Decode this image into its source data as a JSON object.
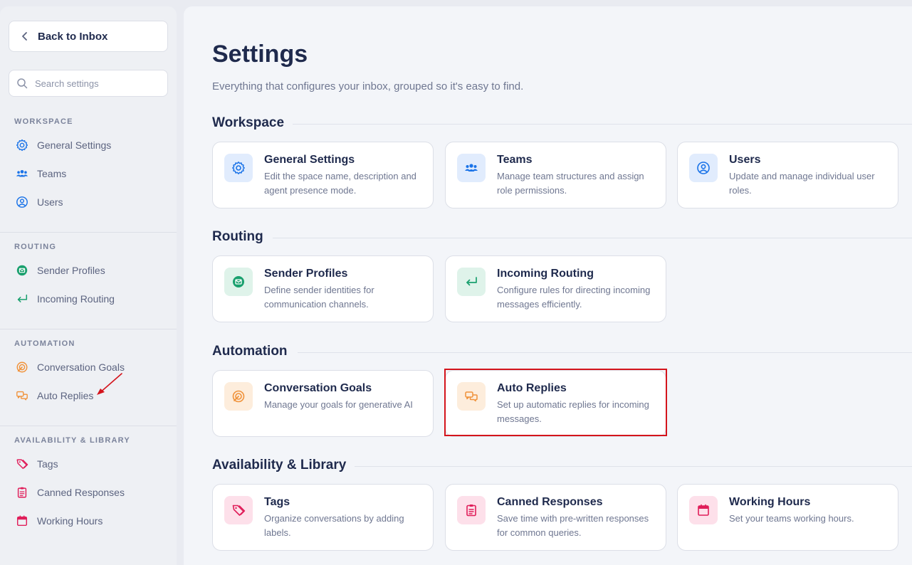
{
  "sidebar": {
    "back_label": "Back to Inbox",
    "search_placeholder": "Search settings",
    "groups": [
      {
        "title": "WORKSPACE",
        "items": [
          {
            "label": "General Settings",
            "icon": "gear-icon"
          },
          {
            "label": "Teams",
            "icon": "teams-icon"
          },
          {
            "label": "Users",
            "icon": "user-circle-icon"
          }
        ]
      },
      {
        "title": "ROUTING",
        "items": [
          {
            "label": "Sender Profiles",
            "icon": "mail-circle-icon"
          },
          {
            "label": "Incoming Routing",
            "icon": "return-arrow-icon"
          }
        ]
      },
      {
        "title": "AUTOMATION",
        "items": [
          {
            "label": "Conversation Goals",
            "icon": "target-icon"
          },
          {
            "label": "Auto Replies",
            "icon": "chat-bubbles-icon"
          }
        ]
      },
      {
        "title": "AVAILABILITY & LIBRARY",
        "items": [
          {
            "label": "Tags",
            "icon": "tag-icon"
          },
          {
            "label": "Canned Responses",
            "icon": "clipboard-icon"
          },
          {
            "label": "Working Hours",
            "icon": "calendar-icon"
          }
        ]
      }
    ]
  },
  "main": {
    "title": "Settings",
    "subtitle": "Everything that configures your inbox, grouped so it's easy to find.",
    "sections": [
      {
        "title": "Workspace",
        "cards": [
          {
            "title": "General Settings",
            "desc": "Edit the space name, description and agent presence mode.",
            "icon": "gear-icon"
          },
          {
            "title": "Teams",
            "desc": "Manage team structures and assign role permissions.",
            "icon": "teams-icon"
          },
          {
            "title": "Users",
            "desc": "Update and manage individual user roles.",
            "icon": "user-circle-icon"
          }
        ]
      },
      {
        "title": "Routing",
        "cards": [
          {
            "title": "Sender Profiles",
            "desc": "Define sender identities for communication channels.",
            "icon": "mail-circle-icon"
          },
          {
            "title": "Incoming Routing",
            "desc": "Configure rules for directing incoming messages efficiently.",
            "icon": "return-arrow-icon"
          }
        ]
      },
      {
        "title": "Automation",
        "cards": [
          {
            "title": "Conversation Goals",
            "desc": "Manage your goals for generative AI",
            "icon": "target-icon"
          },
          {
            "title": "Auto Replies",
            "desc": "Set up automatic replies for incoming messages.",
            "icon": "chat-bubbles-icon"
          }
        ]
      },
      {
        "title": "Availability & Library",
        "cards": [
          {
            "title": "Tags",
            "desc": "Organize conversations by adding labels.",
            "icon": "tag-icon"
          },
          {
            "title": "Canned Responses",
            "desc": "Save time with pre-written responses for common queries.",
            "icon": "clipboard-icon"
          },
          {
            "title": "Working Hours",
            "desc": "Set your teams working hours.",
            "icon": "calendar-icon"
          }
        ]
      }
    ]
  },
  "colors": {
    "workspace": "#1a73e8",
    "routing": "#1aa06e",
    "automation": "#f0923a",
    "library": "#e01e5a",
    "highlight": "#d4141c"
  }
}
